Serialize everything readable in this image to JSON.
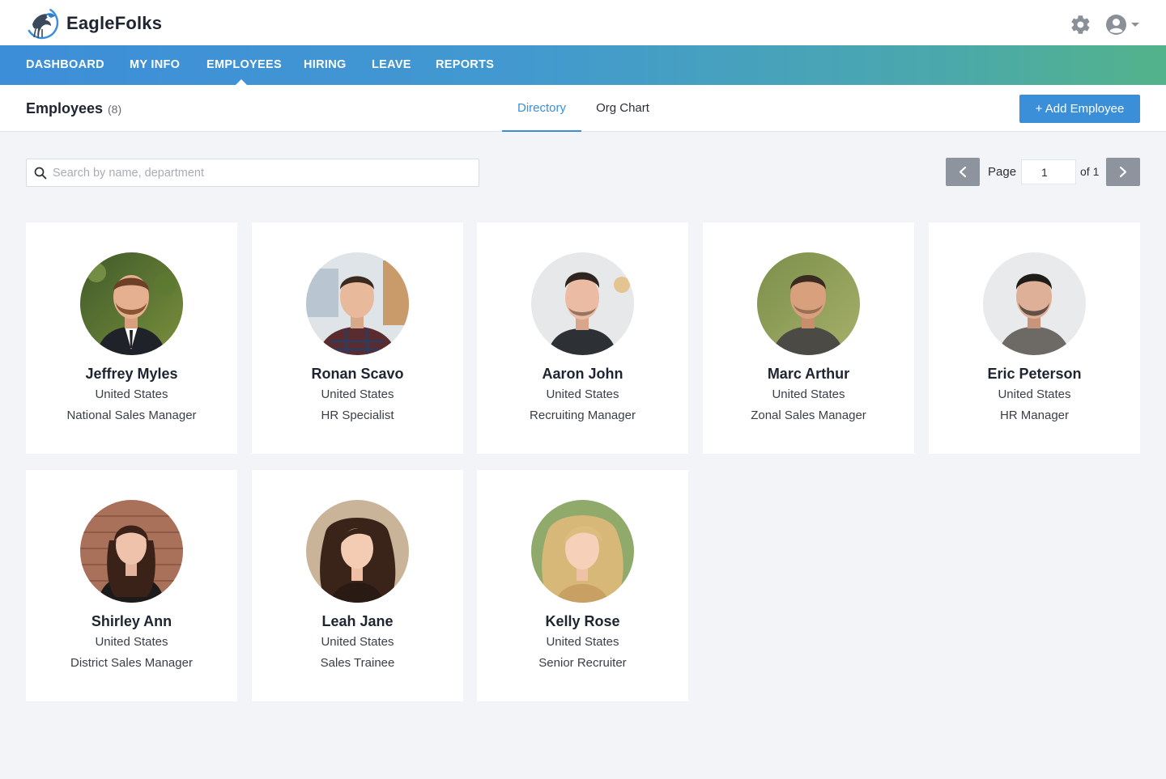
{
  "app": {
    "brand": "EagleFolks"
  },
  "nav": {
    "items": [
      "DASHBOARD",
      "MY INFO",
      "EMPLOYEES",
      "HIRING",
      "LEAVE",
      "REPORTS"
    ],
    "active": "EMPLOYEES"
  },
  "header": {
    "title": "Employees",
    "count": "(8)",
    "tabs": [
      "Directory",
      "Org Chart"
    ],
    "active_tab": "Directory",
    "add_button": "+ Add Employee"
  },
  "search": {
    "placeholder": "Search by name, department",
    "value": ""
  },
  "pagination": {
    "label": "Page",
    "current": "1",
    "of_label": "of 1"
  },
  "employees": [
    {
      "name": "Jeffrey Myles",
      "country": "United States",
      "role": "National Sales Manager"
    },
    {
      "name": "Ronan Scavo",
      "country": "United States",
      "role": "HR Specialist"
    },
    {
      "name": "Aaron John",
      "country": "United States",
      "role": "Recruiting Manager"
    },
    {
      "name": "Marc Arthur",
      "country": "United States",
      "role": "Zonal Sales Manager"
    },
    {
      "name": "Eric Peterson",
      "country": "United States",
      "role": "HR Manager"
    },
    {
      "name": "Shirley Ann",
      "country": "United States",
      "role": "District Sales Manager"
    },
    {
      "name": "Leah Jane",
      "country": "United States",
      "role": "Sales Trainee"
    },
    {
      "name": "Kelly Rose",
      "country": "United States",
      "role": "Senior Recruiter"
    }
  ],
  "icons": {
    "logo": "eagle-logo-icon",
    "settings": "gear-icon",
    "user": "user-circle-icon",
    "search": "search-icon",
    "prev": "chevron-left-icon",
    "next": "chevron-right-icon"
  },
  "colors": {
    "primary": "#3b8fd9",
    "nav_gradient_start": "#3d8ed8",
    "nav_gradient_end": "#53b38a",
    "background": "#f3f4f8",
    "pager_button": "#8e949e"
  }
}
